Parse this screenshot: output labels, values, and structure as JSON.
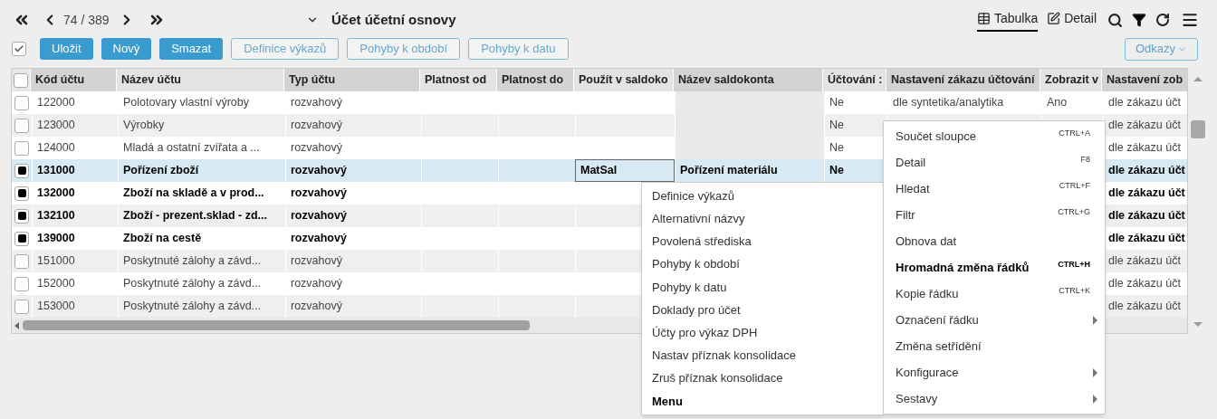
{
  "pager": {
    "position": "74 / 389"
  },
  "title": "Účet účetní osnovy",
  "views": [
    {
      "label": "Tabulka",
      "kind": "table",
      "selected": true
    },
    {
      "label": "Detail",
      "kind": "detail",
      "selected": false
    }
  ],
  "select_all": {
    "checked": true
  },
  "actions": [
    {
      "label": "Uložit",
      "kind": "primary"
    },
    {
      "label": "Nový",
      "kind": "primary"
    },
    {
      "label": "Smazat",
      "kind": "primary"
    },
    {
      "label": "Definice výkazů",
      "kind": "outline"
    },
    {
      "label": "Pohyby k období",
      "kind": "outline"
    },
    {
      "label": "Pohyby k datu",
      "kind": "outline"
    }
  ],
  "links_button": "Odkazy",
  "table": {
    "all_checked": false,
    "columns": [
      "Kód účtu",
      "Název účtu",
      "Typ účtu",
      "Platnost od",
      "Platnost do",
      "Použít v saldoko",
      "Název saldokonta",
      "Účtování :",
      "Nastavení zákazu účtování",
      "Zobrazit v",
      "Nastavení zob"
    ],
    "rows": [
      {
        "checked": false,
        "selected": false,
        "focused": false,
        "code": "122000",
        "name": "Polotovary vlastní výroby",
        "type": "rozvahový",
        "posting": "Ne",
        "ban": "dle syntetika/analytika",
        "show": "Ano",
        "show_setting": "dle zákazu účt"
      },
      {
        "checked": false,
        "selected": false,
        "focused": false,
        "code": "123000",
        "name": "Výrobky",
        "type": "rozvahový",
        "posting": "Ne",
        "show_setting": "dle zákazu účt"
      },
      {
        "checked": false,
        "selected": false,
        "focused": false,
        "code": "124000",
        "name": "Mladá a ostatní zvířata a ...",
        "type": "rozvahový",
        "posting": "Ne",
        "show_setting": "dle zákazu účt"
      },
      {
        "checked": true,
        "selected": true,
        "focused": true,
        "code": "131000",
        "name": "Pořízení zboží",
        "type": "rozvahový",
        "saldo_use": "MatSal",
        "saldo_name": "Pořízení materiálu",
        "posting": "Ne",
        "show_setting": "dle zákazu účt"
      },
      {
        "checked": true,
        "selected": false,
        "focused": false,
        "code": "132000",
        "name": "Zboží na skladě a v prod...",
        "type": "rozvahový",
        "show_setting": "dle zákazu účt"
      },
      {
        "checked": true,
        "selected": false,
        "focused": false,
        "code": "132100",
        "name": "Zboží - prezent.sklad - zd...",
        "type": "rozvahový",
        "show_setting": "dle zákazu účt"
      },
      {
        "checked": true,
        "selected": false,
        "focused": false,
        "code": "139000",
        "name": "Zboží na cestě",
        "type": "rozvahový",
        "show_setting": "dle zákazu účt"
      },
      {
        "checked": false,
        "selected": false,
        "focused": false,
        "code": "151000",
        "name": "Poskytnuté zálohy a závd...",
        "type": "rozvahový",
        "show_setting": "dle zákazu účt"
      },
      {
        "checked": false,
        "selected": false,
        "focused": false,
        "code": "152000",
        "name": "Poskytnuté zálohy a závd...",
        "type": "rozvahový",
        "show_setting": "dle zákazu účt"
      },
      {
        "checked": false,
        "selected": false,
        "focused": false,
        "code": "153000",
        "name": "Poskytnuté zálohy a závd...",
        "type": "rozvahový",
        "show_setting": "dle zákazu účt"
      }
    ]
  },
  "row_menu": {
    "items": [
      {
        "label": "Definice výkazů",
        "bold": false
      },
      {
        "label": "Alternativní názvy",
        "bold": false
      },
      {
        "label": "Povolená střediska",
        "bold": false
      },
      {
        "label": "Pohyby k období",
        "bold": false
      },
      {
        "label": "Pohyby k datu",
        "bold": false
      },
      {
        "label": "Doklady pro účet",
        "bold": false
      },
      {
        "label": "Účty pro výkaz DPH",
        "bold": false
      },
      {
        "label": "Nastav příznak konsolidace",
        "bold": false
      },
      {
        "label": "Zruš příznak konsolidace",
        "bold": false
      },
      {
        "label": "Menu",
        "bold": true
      }
    ]
  },
  "grid_menu": {
    "items": [
      {
        "label": "Součet sloupce",
        "shortcut": "CTRL+A",
        "submenu": false,
        "bold": false
      },
      {
        "label": "Detail",
        "shortcut": "F8",
        "submenu": false,
        "bold": false
      },
      {
        "label": "Hledat",
        "shortcut": "CTRL+F",
        "submenu": false,
        "bold": false
      },
      {
        "label": "Filtr",
        "shortcut": "CTRL+G",
        "submenu": false,
        "bold": false
      },
      {
        "label": "Obnova dat",
        "submenu": false,
        "bold": false
      },
      {
        "label": "Hromadná změna řádků",
        "shortcut": "CTRL+H",
        "submenu": false,
        "bold": true
      },
      {
        "label": "Kopie řádku",
        "shortcut": "CTRL+K",
        "submenu": false,
        "bold": false
      },
      {
        "label": "Označení řádku",
        "submenu": true,
        "bold": false
      },
      {
        "label": "Změna setřídění",
        "submenu": false,
        "bold": false
      },
      {
        "label": "Konfigurace",
        "submenu": true,
        "bold": false
      },
      {
        "label": "Sestavy",
        "submenu": true,
        "bold": false
      }
    ]
  }
}
